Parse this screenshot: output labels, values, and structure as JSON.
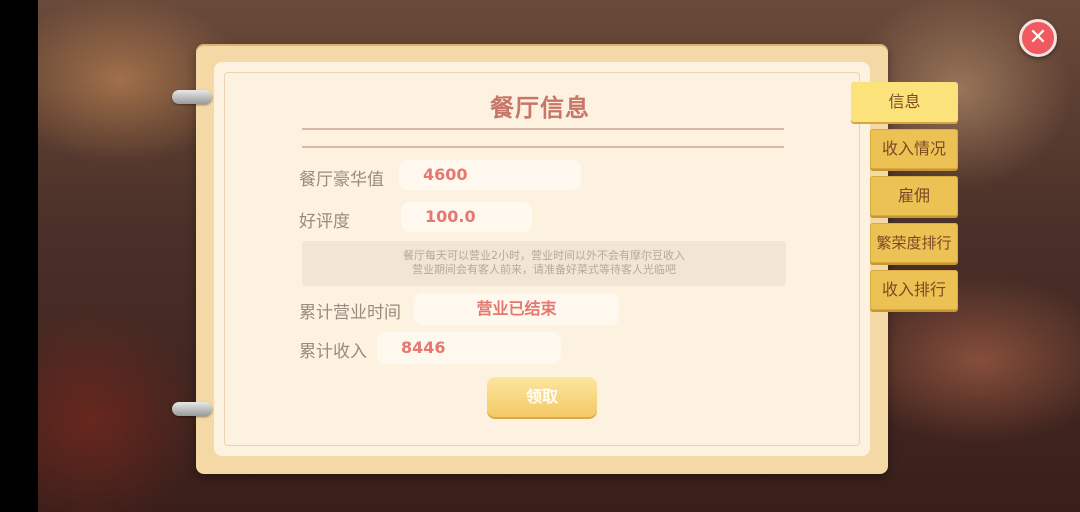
{
  "panel": {
    "title": "餐厅信息"
  },
  "stats": {
    "luxury_label": "餐厅豪华值",
    "luxury_value": "4600",
    "rating_label": "好评度",
    "rating_value": "100.0",
    "note_line1": "餐厅每天可以营业2小时，营业时间以外不会有摩尔豆收入",
    "note_line2": "营业期间会有客人前来，请准备好菜式等待客人光临吧",
    "business_time_label": "累计营业时间",
    "business_time_value": "营业已结束",
    "income_label": "累计收入",
    "income_value": "8446"
  },
  "actions": {
    "claim_label": "领取"
  },
  "tabs": [
    {
      "label": "信息",
      "active": true
    },
    {
      "label": "收入情况",
      "active": false
    },
    {
      "label": "雇佣",
      "active": false
    },
    {
      "label": "繁荣度排行",
      "active": false
    },
    {
      "label": "收入排行",
      "active": false
    }
  ],
  "close": {
    "icon": "close-icon",
    "glyph": "✕"
  }
}
